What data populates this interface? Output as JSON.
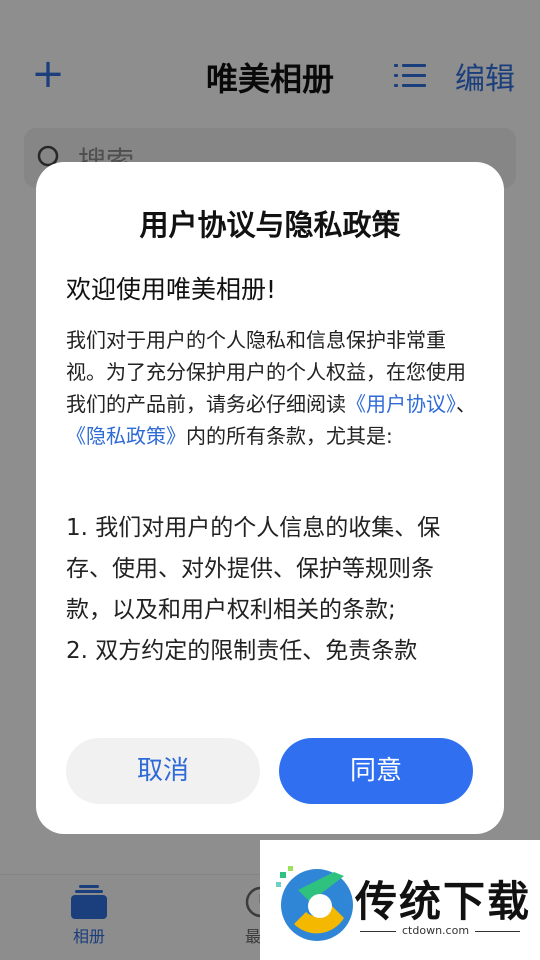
{
  "app": {
    "title": "唯美相册",
    "add_label": "+",
    "edit_label": "编辑",
    "search_placeholder": "搜索"
  },
  "bottom_nav": {
    "items": [
      {
        "label": "相册",
        "icon": "album-icon",
        "active": true
      },
      {
        "label": "最近",
        "icon": "clock-icon",
        "active": false
      }
    ]
  },
  "dialog": {
    "title": "用户协议与隐私政策",
    "welcome": "欢迎使用唯美相册!",
    "intro_part1": "我们对于用户的个人隐私和信息保护非常重视。为了充分保护用户的个人权益，在您使用我们的产品前，请务必仔细阅读",
    "link_user_agreement": "《用户协议》",
    "separator": "、",
    "link_privacy_policy": "《隐私政策》",
    "intro_part2": "内的所有条款，尤其是:",
    "term_1": "1. 我们对用户的个人信息的收集、保存、使用、对外提供、保护等规则条款，以及和用户权利相关的条款;",
    "term_2": "2. 双方约定的限制责任、免责条款",
    "cancel_label": "取消",
    "agree_label": "同意"
  },
  "watermark": {
    "text": "传统下载",
    "url": "ctdown.com"
  },
  "colors": {
    "accent": "#2f6bd6",
    "agree_button": "#2f6ff0",
    "overlay": "rgba(0,0,0,0.42)"
  }
}
